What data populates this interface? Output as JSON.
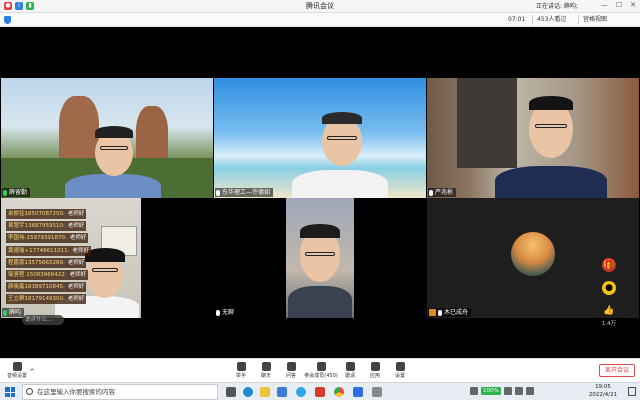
{
  "window": {
    "title": "腾讯会议",
    "speaking": "正在讲话: 薛昀;",
    "minimize": "—",
    "maximize": "☐",
    "close": "✕"
  },
  "meeting_bar": {
    "timer": "07:01",
    "participants": "453人看过",
    "view_mode": "宫格视图"
  },
  "tiles": [
    {
      "name": "薛留勤",
      "mic": "green"
    },
    {
      "name": "东华理工—许德如",
      "mic": "white"
    },
    {
      "name": "严兆彬",
      "mic": "white"
    },
    {
      "name": "薛昀",
      "mic": "green"
    },
    {
      "name": "无聊",
      "mic": "white"
    },
    {
      "name": "木已成舟",
      "mic": "white",
      "host": true
    }
  ],
  "chat": {
    "messages": [
      {
        "name": "余姣钰18507087250:",
        "text": "老师好"
      },
      {
        "name": "易慧宇13687959510:",
        "text": "老师好"
      },
      {
        "name": "李国伟-15979391870:",
        "text": "老师好"
      },
      {
        "name": "黄遵瑜+17746611011:",
        "text": "老师好"
      },
      {
        "name": "程嘉豪13575665289:",
        "text": "老师好"
      },
      {
        "name": "邹竖程 15083966422:",
        "text": "老师好"
      },
      {
        "name": "颜晓鑫18389710845:",
        "text": "老师好"
      },
      {
        "name": "王立群18179149300:",
        "text": "老师好"
      }
    ],
    "input_placeholder": "说点什么..."
  },
  "reactions": {
    "like_count": "1.4万"
  },
  "toolbar": {
    "audio": "音频设置",
    "items": [
      "举手",
      "聊天",
      "问答",
      "参会成员(450)",
      "邀请",
      "应用",
      "设置"
    ],
    "end": "离开会议"
  },
  "taskbar": {
    "search_placeholder": "在这里输入你要搜索的内容",
    "battery": "100%",
    "time": "19:05",
    "date": "2022/4/21"
  }
}
